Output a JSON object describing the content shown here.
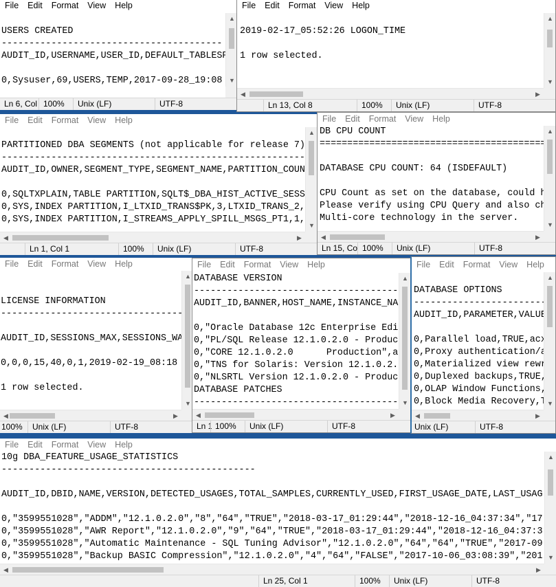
{
  "menu": {
    "file": "File",
    "edit": "Edit",
    "format": "Format",
    "view": "View",
    "help": "Help"
  },
  "windows": {
    "users_created": {
      "lines": [
        "",
        "USERS CREATED",
        "----------------------------------------",
        "AUDIT_ID,USERNAME,USER_ID,DEFAULT_TABLESPACE",
        "",
        "0,Sysuser,69,USERS,TEMP,2017-09-28_19:08"
      ],
      "status": {
        "pos": "Ln 6, Col 1",
        "zoom": "100%",
        "eol": "Unix (LF)",
        "enc": "UTF-8"
      }
    },
    "logon_time": {
      "lines": [
        "",
        "2019-02-17_05:52:26 LOGON_TIME",
        "",
        "1 row selected."
      ],
      "status": {
        "pos": "Ln 13, Col 8",
        "zoom": "100%",
        "eol": "Unix (LF)",
        "enc": "UTF-8"
      }
    },
    "partitioned": {
      "lines": [
        "",
        "PARTITIONED DBA SEGMENTS (not applicable for release 7)",
        "--------------------------------------------------------",
        "AUDIT_ID,OWNER,SEGMENT_TYPE,SEGMENT_NAME,PARTITION_COUNT",
        "",
        "0,SQLTXPLAIN,TABLE PARTITION,SQLT$_DBA_HIST_ACTIVE_SESS",
        "0,SYS,INDEX PARTITION,I_LTXID_TRANS$PK,3,LTXID_TRANS_2,",
        "0,SYS,INDEX PARTITION,I_STREAMS_APPLY_SPILL_MSGS_PT1,1,"
      ],
      "status": {
        "pos": "Ln 1, Col 1",
        "zoom": "100%",
        "eol": "Unix (LF)",
        "enc": "UTF-8"
      }
    },
    "cpu_count": {
      "lines": [
        "DB CPU COUNT",
        "==============================================",
        "",
        "DATABASE CPU COUNT: 64 (ISDEFAULT)",
        "",
        "CPU Count as set on the database, could h",
        "Please verify using CPU Query and also ch",
        "Multi-core technology in the server."
      ],
      "status": {
        "pos": "Ln 15, Co",
        "zoom": "100%",
        "eol": "Unix (LF)",
        "enc": "UTF-8"
      }
    },
    "license": {
      "lines": [
        "",
        "",
        "LICENSE INFORMATION",
        "----------------------------------------",
        "",
        "AUDIT_ID,SESSIONS_MAX,SESSIONS_WA",
        "",
        "0,0,0,15,40,0,1,2019-02-19_08:18",
        "",
        "1 row selected."
      ],
      "status": {
        "zoom": "100%",
        "eol": "Unix (LF)",
        "enc": "UTF-8"
      }
    },
    "db_version": {
      "lines": [
        "DATABASE VERSION",
        "----------------------------------------",
        "AUDIT_ID,BANNER,HOST_NAME,INSTANCE_NA",
        "",
        "0,\"Oracle Database 12c Enterprise Edi",
        "0,\"PL/SQL Release 12.1.0.2.0 - Produc",
        "0,\"CORE 12.1.0.2.0      Production\",a",
        "0,\"TNS for Solaris: Version 12.1.0.2.",
        "0,\"NLSRTL Version 12.1.0.2.0 - Produc",
        "DATABASE PATCHES",
        "----------------------------------------"
      ],
      "status": {
        "pos": "Ln 1",
        "zoom": "100%",
        "eol": "Unix (LF)",
        "enc": "UTF-8"
      }
    },
    "db_options": {
      "lines": [
        "",
        "DATABASE OPTIONS",
        "----------------------------",
        "AUDIT_ID,PARAMETER,VALUE",
        "",
        "0,Parallel load,TRUE,acx",
        "0,Proxy authentication/a",
        "0,Materialized view rewr",
        "0,Duplexed backups,TRUE,",
        "0,OLAP Window Functions,",
        "0,Block Media Recovery,T"
      ],
      "status": {
        "eol": "Unix (LF)",
        "enc": "UTF-8"
      }
    },
    "feature_usage": {
      "lines": [
        "10g DBA_FEATURE_USAGE_STATISTICS",
        "----------------------------------------------",
        "",
        "AUDIT_ID,DBID,NAME,VERSION,DETECTED_USAGES,TOTAL_SAMPLES,CURRENTLY_USED,FIRST_USAGE_DATE,LAST_USAG",
        "",
        "0,\"3599551028\",\"ADDM\",\"12.1.0.2.0\",\"8\",\"64\",\"TRUE\",\"2018-03-17_01:29:44\",\"2018-12-16_04:37:34\",\"17",
        "0,\"3599551028\",\"AWR Report\",\"12.1.0.2.0\",\"9\",\"64\",\"TRUE\",\"2018-03-17_01:29:44\",\"2018-12-16_04:37:3",
        "0,\"3599551028\",\"Automatic Maintenance - SQL Tuning Advisor\",\"12.1.0.2.0\",\"64\",\"64\",\"TRUE\",\"2017-09",
        "0,\"3599551028\",\"Backup BASIC Compression\",\"12.1.0.2.0\",\"4\",\"64\",\"FALSE\",\"2017-10-06_03:08:39\",\"201"
      ],
      "status": {
        "pos": "Ln 25, Col 1",
        "zoom": "100%",
        "eol": "Unix (LF)",
        "enc": "UTF-8"
      }
    }
  }
}
